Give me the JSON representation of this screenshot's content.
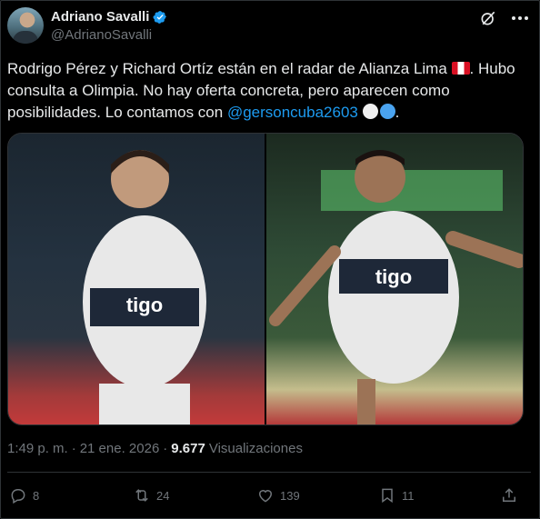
{
  "author": {
    "name": "Adriano Savalli",
    "handle": "@AdrianoSavalli"
  },
  "tweet": {
    "part1": "Rodrigo Pérez y Richard Ortíz están en el radar de Alianza Lima",
    "part2": ". Hubo consulta a Olimpia. No hay oferta concreta, pero aparecen como posibilidades. Lo contamos con",
    "mention": "@gersoncuba2603"
  },
  "media": {
    "left_photo_icon": "player-photo-icon",
    "right_photo_icon": "player-celebrating-photo-icon"
  },
  "meta": {
    "time": "1:49 p. m.",
    "dot": "·",
    "date": "21 ene. 2026",
    "views_count": "9.677",
    "views_label": "Visualizaciones"
  },
  "actions": {
    "replies": "8",
    "reposts": "24",
    "likes": "139",
    "bookmarks": "11"
  },
  "colors": {
    "accent": "#1d9bf0",
    "text": "#e7e9ea",
    "muted": "#71767b",
    "border": "#2f3336"
  }
}
